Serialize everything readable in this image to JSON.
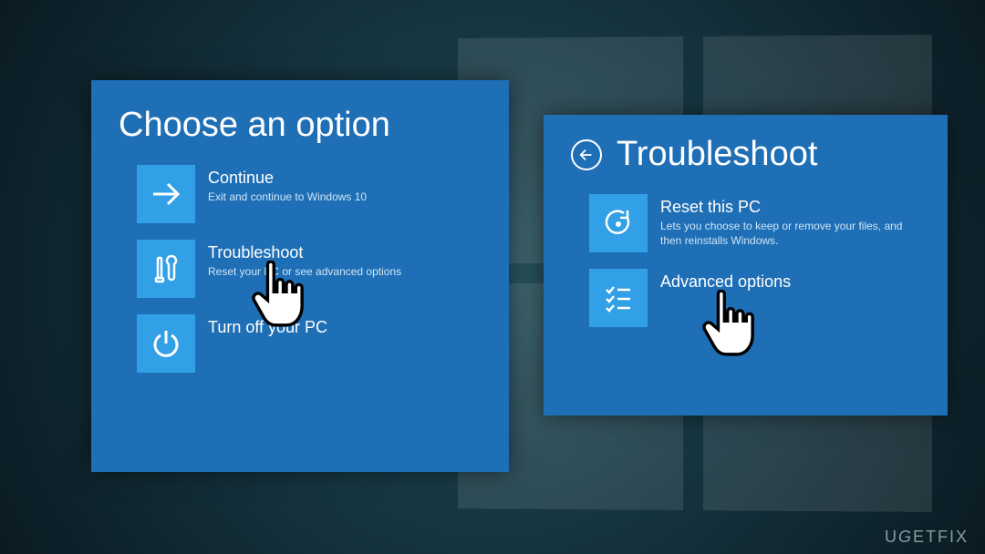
{
  "left_panel": {
    "title": "Choose an option",
    "options": [
      {
        "label": "Continue",
        "desc": "Exit and continue to Windows 10"
      },
      {
        "label": "Troubleshoot",
        "desc": "Reset your PC or see advanced options"
      },
      {
        "label": "Turn off your PC",
        "desc": ""
      }
    ]
  },
  "right_panel": {
    "title": "Troubleshoot",
    "options": [
      {
        "label": "Reset this PC",
        "desc": "Lets you choose to keep or remove your files, and then reinstalls Windows."
      },
      {
        "label": "Advanced options",
        "desc": ""
      }
    ]
  },
  "watermark": "UGETFIX"
}
